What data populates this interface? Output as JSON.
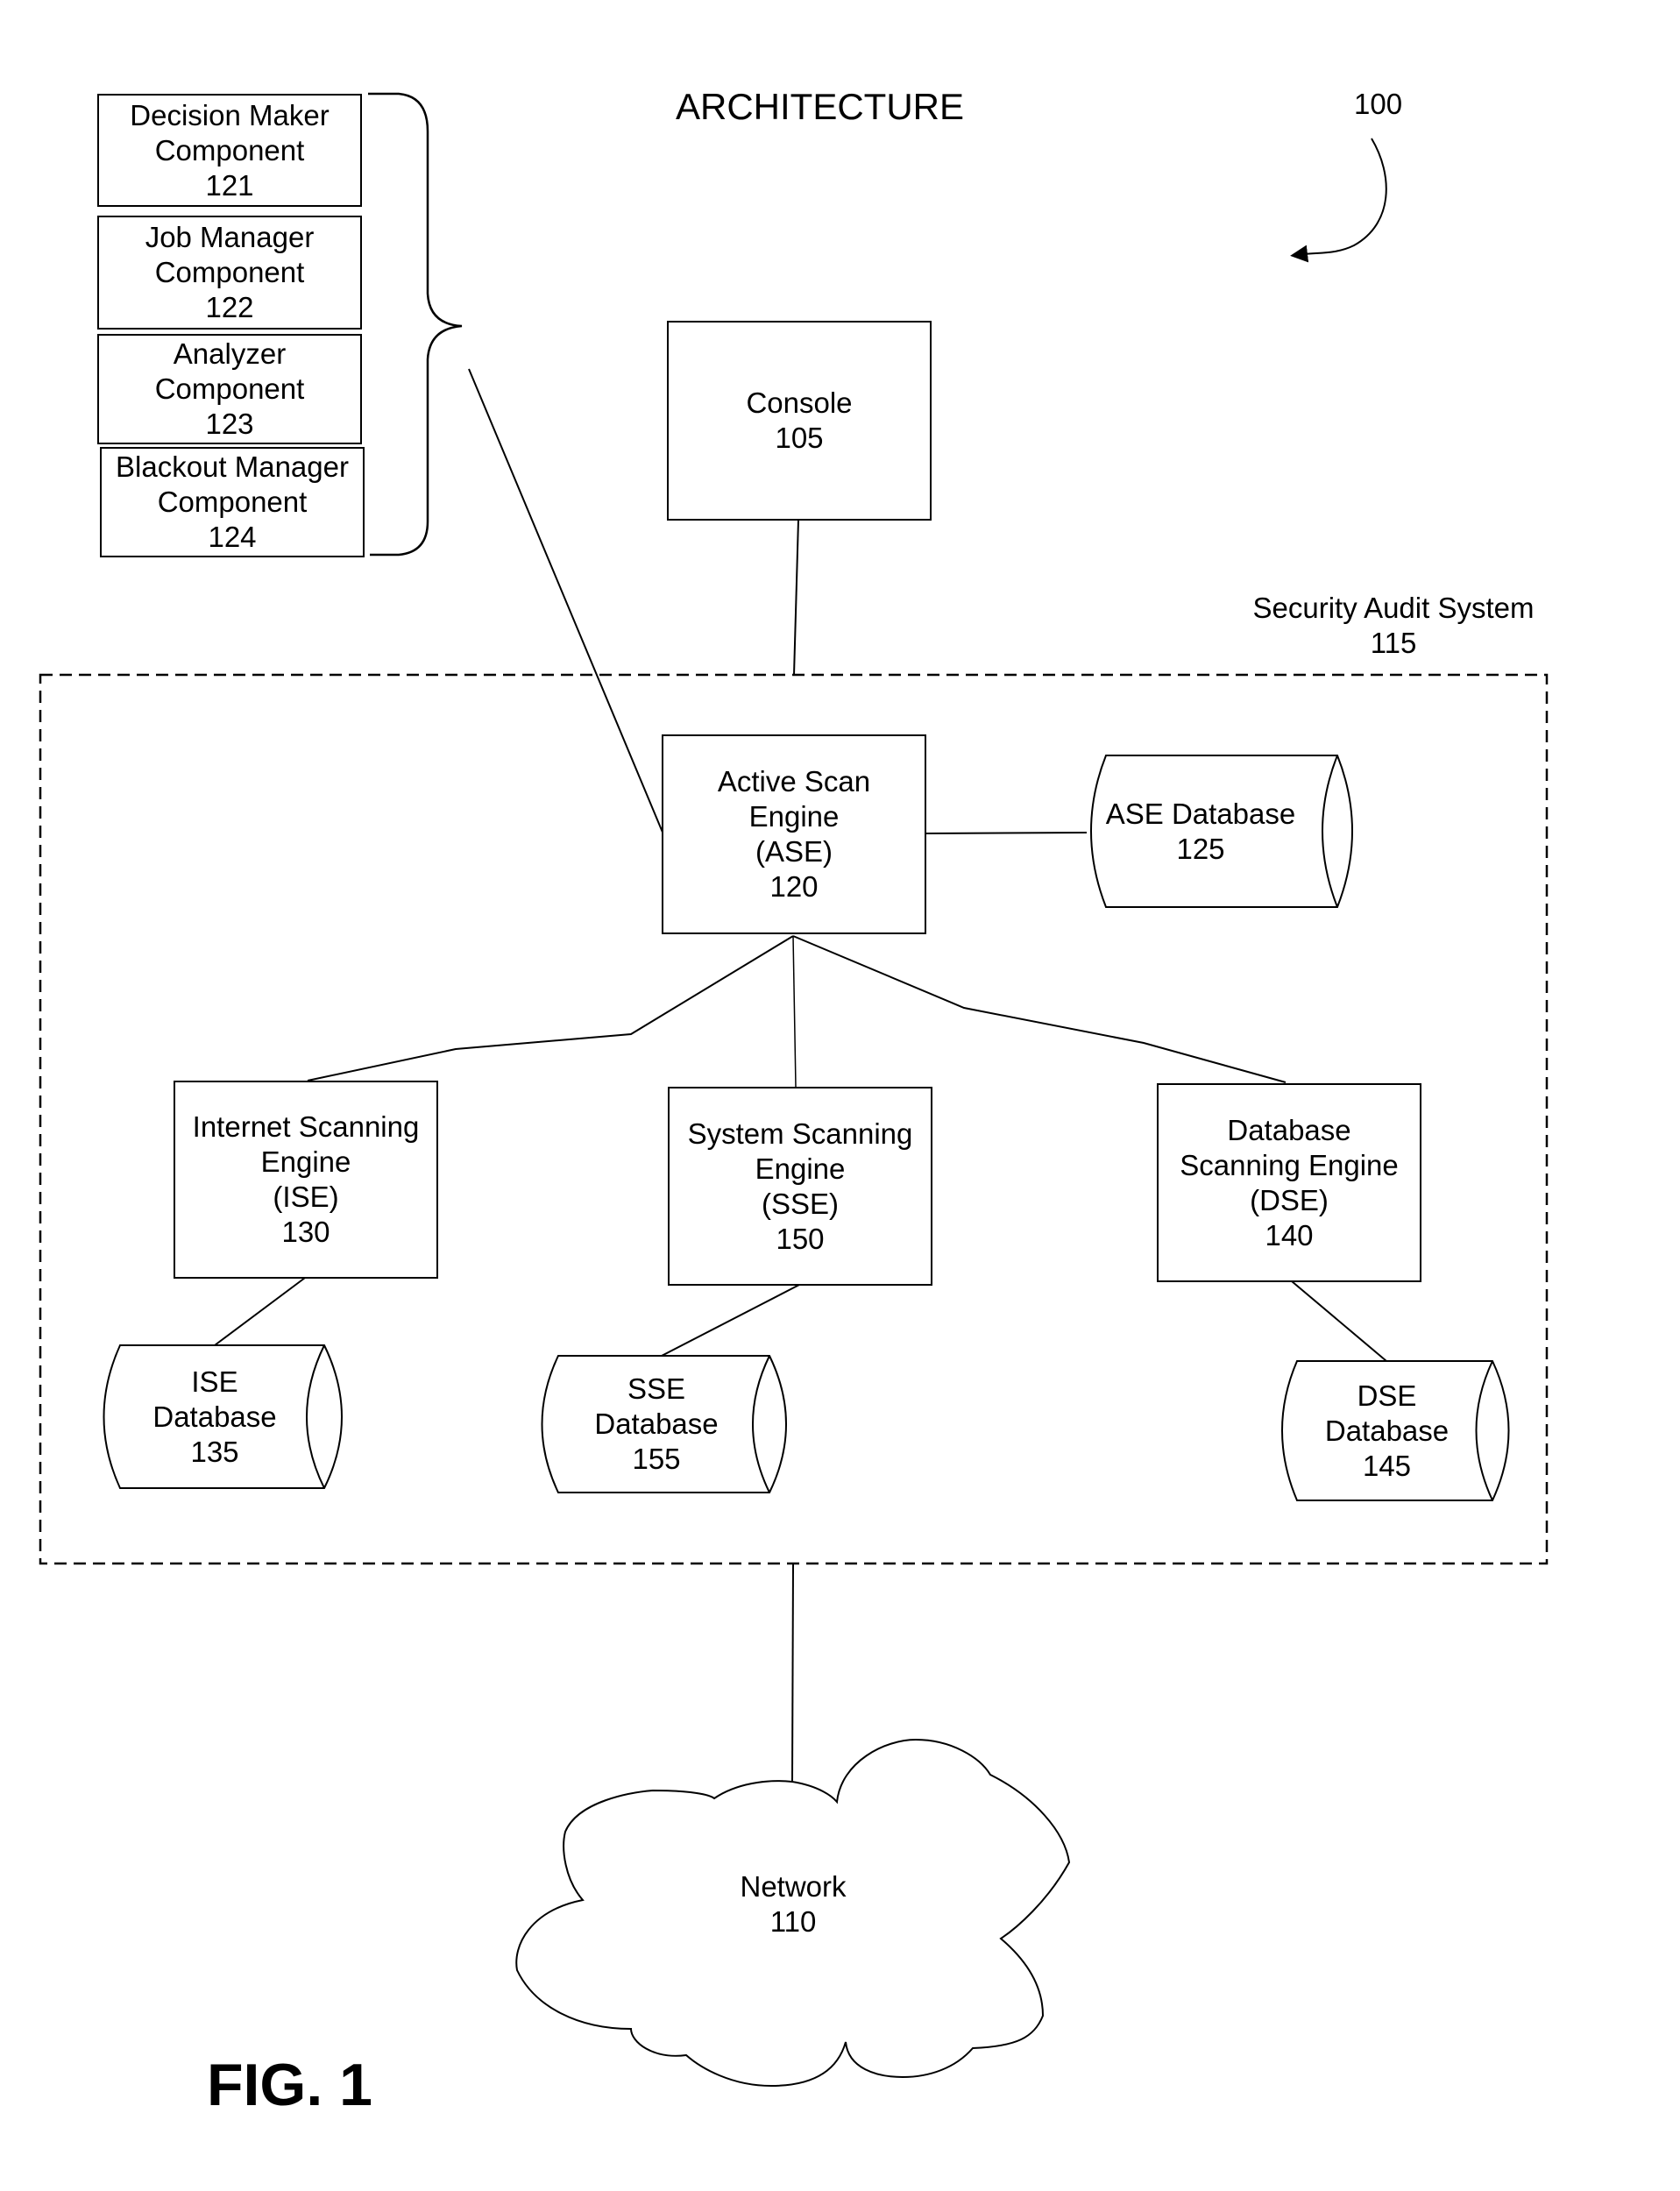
{
  "title": "ARCHITECTURE",
  "figure_ref": "100",
  "figure_label": "FIG. 1",
  "components": [
    {
      "name": "Decision Maker",
      "line2": "Component",
      "ref": "121"
    },
    {
      "name": "Job Manager",
      "line2": "Component",
      "ref": "122"
    },
    {
      "name": "Analyzer",
      "line2": "Component",
      "ref": "123"
    },
    {
      "name": "Blackout Manager",
      "line2": "Component",
      "ref": "124"
    }
  ],
  "console": {
    "name": "Console",
    "ref": "105"
  },
  "security_audit_system": {
    "name": "Security Audit System",
    "ref": "115"
  },
  "ase": {
    "line1": "Active Scan",
    "line2": "Engine",
    "abbr": "(ASE)",
    "ref": "120"
  },
  "ase_db": {
    "name": "ASE Database",
    "ref": "125"
  },
  "ise": {
    "line1": "Internet Scanning",
    "line2": "Engine",
    "abbr": "(ISE)",
    "ref": "130"
  },
  "sse": {
    "line1": "System Scanning",
    "line2": "Engine",
    "abbr": "(SSE)",
    "ref": "150"
  },
  "dse": {
    "line1": "Database",
    "line2": "Scanning Engine",
    "abbr": "(DSE)",
    "ref": "140"
  },
  "ise_db": {
    "line1": "ISE",
    "line2": "Database",
    "ref": "135"
  },
  "sse_db": {
    "line1": "SSE",
    "line2": "Database",
    "ref": "155"
  },
  "dse_db": {
    "line1": "DSE",
    "line2": "Database",
    "ref": "145"
  },
  "network": {
    "name": "Network",
    "ref": "110"
  }
}
